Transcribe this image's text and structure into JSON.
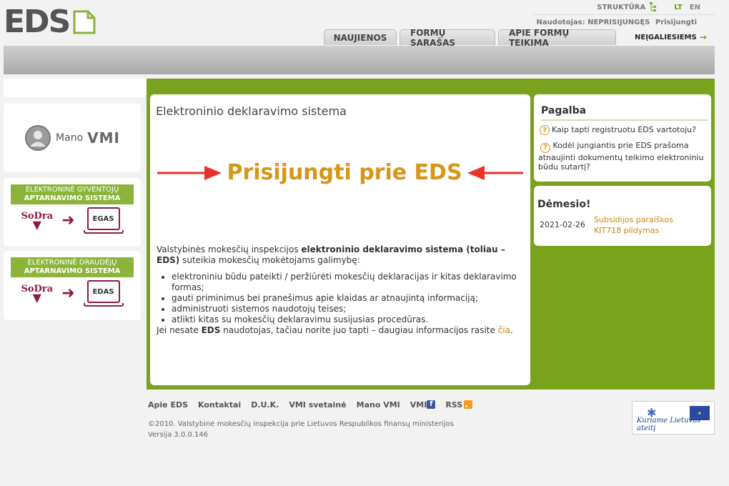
{
  "header": {
    "logo_text": "EDS",
    "struktura": "STRUKTŪRA",
    "lang_lt": "LT",
    "lang_en": "EN",
    "user_label": "Naudotojas: NEPRISIJUNGĘS",
    "login_link": "Prisijungti",
    "tabs": [
      {
        "label": "NAUJIENOS"
      },
      {
        "label": "FORMŲ SĄRAŠAS"
      },
      {
        "label": "APIE FORMŲ TEIKIMĄ"
      }
    ],
    "accessibility_link": "NEĮGALIESIEMS"
  },
  "left": {
    "mano_vmi": {
      "mano": "Mano",
      "vmi": "VMI"
    },
    "egas": {
      "line1": "ELEKTRONINĖ GYVENTOJŲ",
      "line2": "APTARNAVIMO SISTEMA",
      "sodra": "SoDra",
      "system": "EGAS"
    },
    "edas": {
      "line1": "ELEKTRONINĖ DRAUDĖJŲ",
      "line2": "APTARNAVIMO SISTEMA",
      "sodra": "SoDra",
      "system": "EDAS"
    }
  },
  "main": {
    "title": "Elektroninio deklaravimo sistema",
    "big_link": "Prisijungti prie EDS",
    "intro_pre": "Valstybinės mokesčių inspekcijos ",
    "intro_bold": "elektroninio deklaravimo sistema (toliau – EDS)",
    "intro_post": " suteikia mokesčių mokėtojams galimybę:",
    "bullets": [
      "elektroniniu būdu pateikti / peržiūrėti mokesčių deklaracijas ir kitas deklaravimo formas;",
      "gauti priminimus bei pranešimus apie klaidas ar atnaujintą informaciją;",
      "administruoti sistemos naudotojų teises;",
      "atlikti kitas su mokesčių deklaravimu susijusias procedūras."
    ],
    "more_pre": "Jei nesate ",
    "more_bold": "EDS",
    "more_post": " naudotojas, tačiau norite juo tapti – daugiau informacijos rasite ",
    "more_link": "čia",
    "more_end": "."
  },
  "help": {
    "title": "Pagalba",
    "items": [
      "Kaip tapti registruotu EDS vartotoju?",
      "Kodėl jungiantis prie EDS prašoma atnaujinti dokumentų teikimo elektroniniu būdu sutartį?"
    ]
  },
  "attention": {
    "title": "Dėmesio!",
    "date": "2021-02-26",
    "link": "Subsidijos paraiškos KIT718 pildymas"
  },
  "footer": {
    "links": [
      "Apie EDS",
      "Kontaktai",
      "D.U.K.",
      "VMI svetainė",
      "Mano VMI"
    ],
    "vmi_fb": "VMI",
    "fb_glyph": "f",
    "rss": "RSS",
    "copyright": "©2010. Valstybinė mokesčių inspekcija prie Lietuvos Respublikos finansų ministerijos",
    "version": "Versija 3.0.0.146",
    "eu_motto": "Kuriame Lietuvos ateitį"
  },
  "colors": {
    "green": "#79a21d",
    "accent_orange": "#d6961a",
    "sodra": "#8e1b3d",
    "arrow_red": "#e8322a"
  }
}
